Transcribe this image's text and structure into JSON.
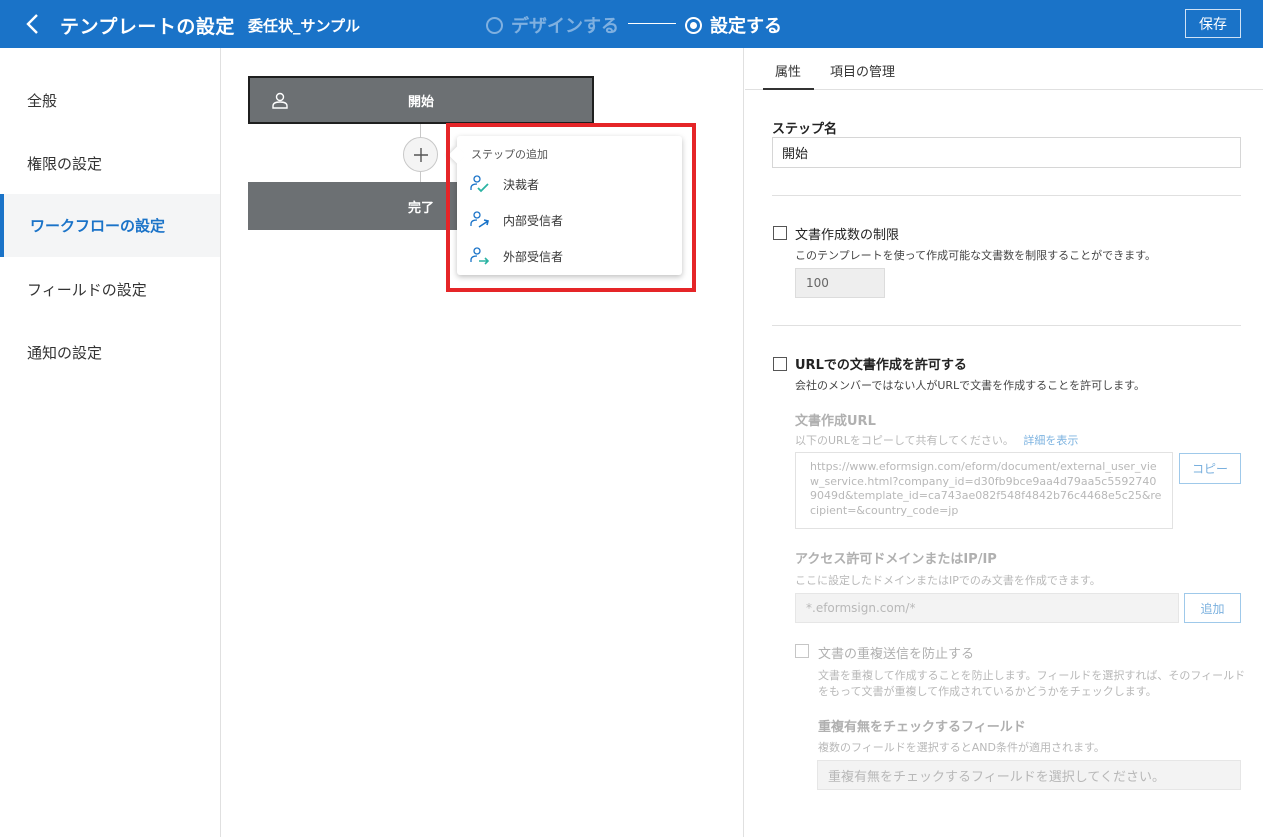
{
  "header": {
    "title": "テンプレートの設定",
    "document_name": "委任状_サンプル",
    "steps": {
      "design": "デザインする",
      "settings": "設定する"
    },
    "save_label": "保存"
  },
  "sidebar": {
    "items": [
      {
        "label": "全般"
      },
      {
        "label": "権限の設定"
      },
      {
        "label": "ワークフローの設定"
      },
      {
        "label": "フィールドの設定"
      },
      {
        "label": "通知の設定"
      }
    ]
  },
  "workflow": {
    "start_label": "開始",
    "end_label": "完了",
    "popup": {
      "title": "ステップの追加",
      "items": [
        {
          "label": "決裁者",
          "icon": "approver-icon"
        },
        {
          "label": "内部受信者",
          "icon": "internal-recipient-icon"
        },
        {
          "label": "外部受信者",
          "icon": "external-recipient-icon"
        }
      ]
    }
  },
  "panel": {
    "tabs": [
      "属性",
      "項目の管理"
    ],
    "step_name_label": "ステップ名",
    "step_name_value": "開始",
    "limit": {
      "label": "文書作成数の制限",
      "desc": "このテンプレートを使って作成可能な文書数を制限することができます。",
      "value": "100"
    },
    "url": {
      "label": "URLでの文書作成を許可する",
      "desc": "会社のメンバーではない人がURLで文書を作成することを許可します。",
      "url_label": "文書作成URL",
      "url_desc": "以下のURLをコピーして共有してください。",
      "detail_link": "詳細を表示",
      "url_value": "https://www.eformsign.com/eform/document/external_user_view_service.html?company_id=d30fb9bce9aa4d79aa5c55927409049d&template_id=ca743ae082f548f4842b76c4468e5c25&recipient=&country_code=jp",
      "copy_label": "コピー",
      "domain_label": "アクセス許可ドメインまたはIP/IP",
      "domain_desc": "ここに設定したドメインまたはIPでのみ文書を作成できます。",
      "domain_placeholder": "*.eformsign.com/*",
      "add_label": "追加",
      "dup_label": "文書の重複送信を防止する",
      "dup_desc1": "文書を重複して作成することを防止します。フィールドを選択すれば、そのフィールド",
      "dup_desc2": "をもって文書が重複して作成されているかどうかをチェックします。",
      "dup_field_label": "重複有無をチェックするフィールド",
      "dup_field_desc": "複数のフィールドを選択するとAND条件が適用されます。",
      "dup_field_placeholder": "重複有無をチェックするフィールドを選択してください。"
    }
  },
  "colors": {
    "header_bg": "#1a73c8",
    "active_nav": "#1a73c8",
    "workflow_box": "#6c7073",
    "highlight": "#e52528",
    "icon_teal": "#2bb3a3"
  }
}
